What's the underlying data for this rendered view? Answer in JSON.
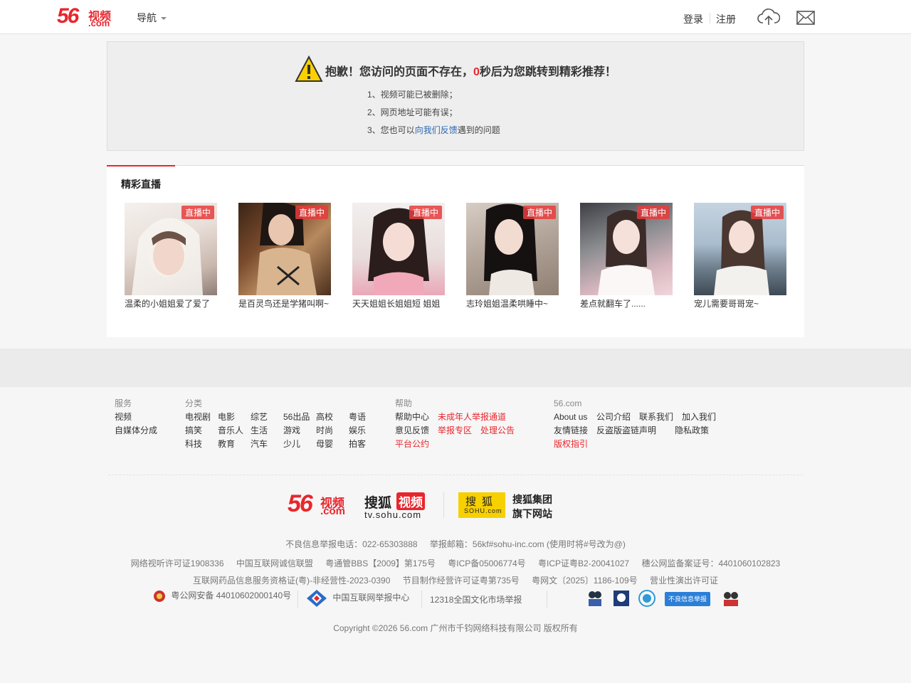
{
  "header": {
    "logo_main": "56",
    "logo_video": "视频",
    "logo_com": ".com",
    "nav_label": "导航",
    "login": "登录",
    "register": "注册",
    "icons": [
      "upload-cloud-icon",
      "mail-icon"
    ]
  },
  "error": {
    "title_before": "抱歉！您访问的页面不存在，",
    "countdown": "0",
    "title_after": "秒后为您跳转到精彩推荐！",
    "reason1": "1、视频可能已被删除；",
    "reason2": "2、网页地址可能有误；",
    "reason3_prefix": "3、您也可以",
    "reason3_link": "向我们反馈",
    "reason3_suffix": "遇到的问题"
  },
  "live": {
    "heading": "精彩直播",
    "badge": "直播中",
    "cards": [
      {
        "title": "温柔的小姐姐爱了爱了"
      },
      {
        "title": "是百灵鸟还是学猪叫啊~"
      },
      {
        "title": "天天姐姐长姐姐短 姐姐"
      },
      {
        "title": "志玲姐姐温柔哄睡中~"
      },
      {
        "title": "差点就翻车了......"
      },
      {
        "title": "宠儿需要哥哥宠~"
      }
    ]
  },
  "footer": {
    "service": {
      "head": "服务",
      "items": [
        "视频",
        "自媒体分成"
      ]
    },
    "category": {
      "head": "分类",
      "row1": [
        "电视剧",
        "电影",
        "综艺",
        "56出品",
        "高校",
        "粤语"
      ],
      "row2": [
        "搞笑",
        "音乐人",
        "生活",
        "游戏",
        "时尚",
        "娱乐"
      ],
      "row3": [
        "科技",
        "教育",
        "汽车",
        "少儿",
        "母婴",
        "拍客"
      ]
    },
    "help": {
      "head": "帮助",
      "row1": [
        "帮助中心",
        "未成年人举报通道"
      ],
      "row2": [
        "意见反馈",
        "举报专区",
        "处理公告"
      ],
      "row3": [
        "平台公约"
      ]
    },
    "site": {
      "head": "56.com",
      "row1": [
        "About us",
        "公司介绍",
        "联系我们",
        "加入我们"
      ],
      "row2": [
        "友情链接",
        "反盗版盗链声明",
        "隐私政策"
      ],
      "row3": [
        "版权指引"
      ]
    },
    "brand": {
      "logo56_main": "56",
      "logo56_video": "视频",
      "logo56_com": ".com",
      "sohutv_1": "搜狐",
      "sohutv_2": "视频",
      "sohutv_3": "tv.sohu.com",
      "sohu_a": "搜狐",
      "sohu_b": "SOHU.com",
      "group_1": "搜狐集团",
      "group_2": "旗下网站"
    },
    "report_phone": "不良信息举报电话：022-65303888",
    "report_mail": "举报邮箱：56kf#sohu-inc.com (使用时将#号改为@)",
    "licenses1": [
      "网络视听许可证1908336",
      "中国互联网诚信联盟",
      "粤通管BBS【2009】第175号",
      "粤ICP备05006774号",
      "粤ICP证粤B2-20041027",
      "穗公网监备案证号：4401060102823"
    ],
    "licenses2": [
      "互联网药品信息服务资格证(粤)-非经营性-2023-0390",
      "节目制作经营许可证粤第735号",
      "粤网文〔2025〕1186-109号",
      "营业性演出许可证"
    ],
    "police": "粤公网安备 44010602000140号",
    "cnreport": "中国互联网举报中心",
    "culture": "12318全国文化市场举报",
    "badge_text": "不良信息举报",
    "copyright": "Copyright ©2026 56.com 广州市千钧网络科技有限公司 版权所有",
    "colors": {
      "brand_red": "#e8262d",
      "link_blue": "#2a66b0",
      "sohu_yellow": "#f7d000"
    }
  }
}
